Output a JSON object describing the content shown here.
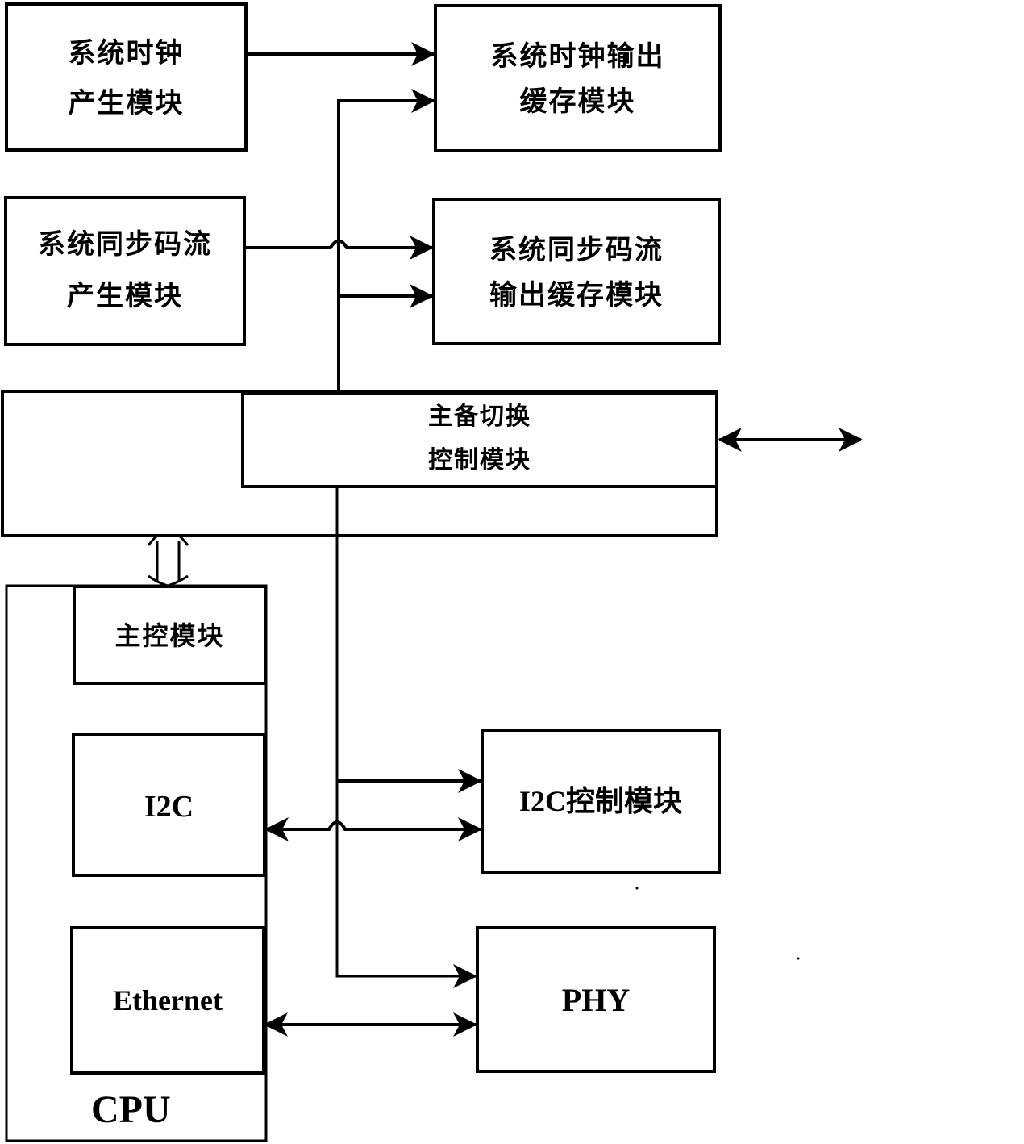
{
  "diagram": {
    "blocks": {
      "clock_gen": {
        "lines": [
          "系统时钟",
          "产生模块"
        ]
      },
      "clock_out": {
        "lines": [
          "系统时钟输出",
          "缓存模块"
        ]
      },
      "sync_gen": {
        "lines": [
          "系统同步码流",
          "产生模块"
        ]
      },
      "sync_out": {
        "lines": [
          "系统同步码流",
          "输出缓存模块"
        ]
      },
      "switch_ctrl": {
        "lines": [
          "主备切换",
          "控制模块"
        ]
      },
      "main_ctrl": {
        "lines": [
          "主控模块"
        ]
      },
      "i2c": {
        "lines": [
          "I2C"
        ]
      },
      "ethernet": {
        "lines": [
          "Ethernet"
        ]
      },
      "cpu": {
        "lines": [
          "CPU"
        ]
      },
      "i2c_ctrl": {
        "lines": [
          "I2C控制模块"
        ]
      },
      "phy": {
        "lines": [
          "PHY"
        ]
      }
    },
    "connections": [
      {
        "from": "系统时钟产生模块",
        "to": "系统时钟输出缓存模块",
        "type": "arrow"
      },
      {
        "from": "主备切换控制模块",
        "to": "系统时钟输出缓存模块",
        "type": "arrow"
      },
      {
        "from": "系统同步码流产生模块",
        "to": "系统同步码流输出缓存模块",
        "type": "arrow"
      },
      {
        "from": "主备切换控制模块",
        "to": "系统同步码流输出缓存模块",
        "type": "arrow"
      },
      {
        "from": "主备切换控制模块",
        "to": "external",
        "type": "bidirectional"
      },
      {
        "from": "主备切换控制模块",
        "to": "主控模块",
        "type": "bus-bidirectional"
      },
      {
        "from": "主备切换控制模块",
        "to": "I2C控制模块",
        "type": "arrow"
      },
      {
        "from": "I2C",
        "to": "I2C控制模块",
        "type": "bidirectional"
      },
      {
        "from": "主备切换控制模块",
        "to": "PHY",
        "type": "arrow"
      },
      {
        "from": "Ethernet",
        "to": "PHY",
        "type": "bidirectional"
      }
    ]
  }
}
